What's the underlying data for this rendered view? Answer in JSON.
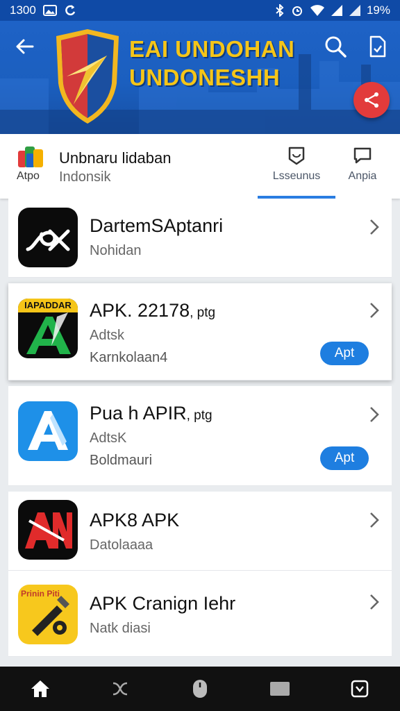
{
  "status_bar": {
    "time": "1300",
    "battery_text": "19%",
    "icons": [
      "image-icon",
      "sync-icon",
      "bluetooth-icon",
      "alarm-icon",
      "wifi-icon",
      "signal-icon",
      "signal-icon"
    ]
  },
  "header": {
    "title_line1": "EAI UNDOHAN",
    "title_line2": "UNDONESHH",
    "colors": {
      "banner": "#1b5fbf",
      "title": "#f5c518",
      "fab": "#e23b3b"
    }
  },
  "subbar": {
    "app_label": "Atpo",
    "title": "Unbnaru lidaban",
    "subtitle": "Indonsik",
    "tabs": [
      {
        "label": "Lsseunus",
        "icon": "shield-chat-icon",
        "active": true
      },
      {
        "label": "Anpia",
        "icon": "chat-icon",
        "active": false
      }
    ]
  },
  "list": {
    "items": [
      {
        "title": "DartemSAptanri",
        "suffix": "",
        "line2": "Nohidan",
        "line3": "",
        "button": "",
        "icon": "pix-logo-icon"
      },
      {
        "title": "APK. 22178",
        "suffix": ", ptg",
        "line2": "Adtsk",
        "line3": "Karnkolaan4",
        "button": "Apt",
        "icon_label": "IAPADDAR",
        "icon": "green-a-logo-icon"
      },
      {
        "title": "Pua h APIR",
        "suffix": ", ptg",
        "line2": "AdtsK",
        "line3": "Boldmauri",
        "button": "Apt",
        "icon": "blue-a-logo-icon"
      },
      {
        "title": "APK8 APK",
        "suffix": "",
        "line2": "Datolaaaa",
        "line3": "",
        "button": "",
        "icon": "red-an-logo-icon"
      },
      {
        "title": "APK Cranign Iehr",
        "suffix": "",
        "line2": "Natk diasi",
        "line3": "",
        "button": "",
        "icon_label": "Prinin Piti",
        "icon": "yellow-tool-logo-icon"
      }
    ]
  },
  "bottom_nav": {
    "icons": [
      "home-icon",
      "tools-icon",
      "mouse-icon",
      "window-icon",
      "archive-icon"
    ]
  }
}
